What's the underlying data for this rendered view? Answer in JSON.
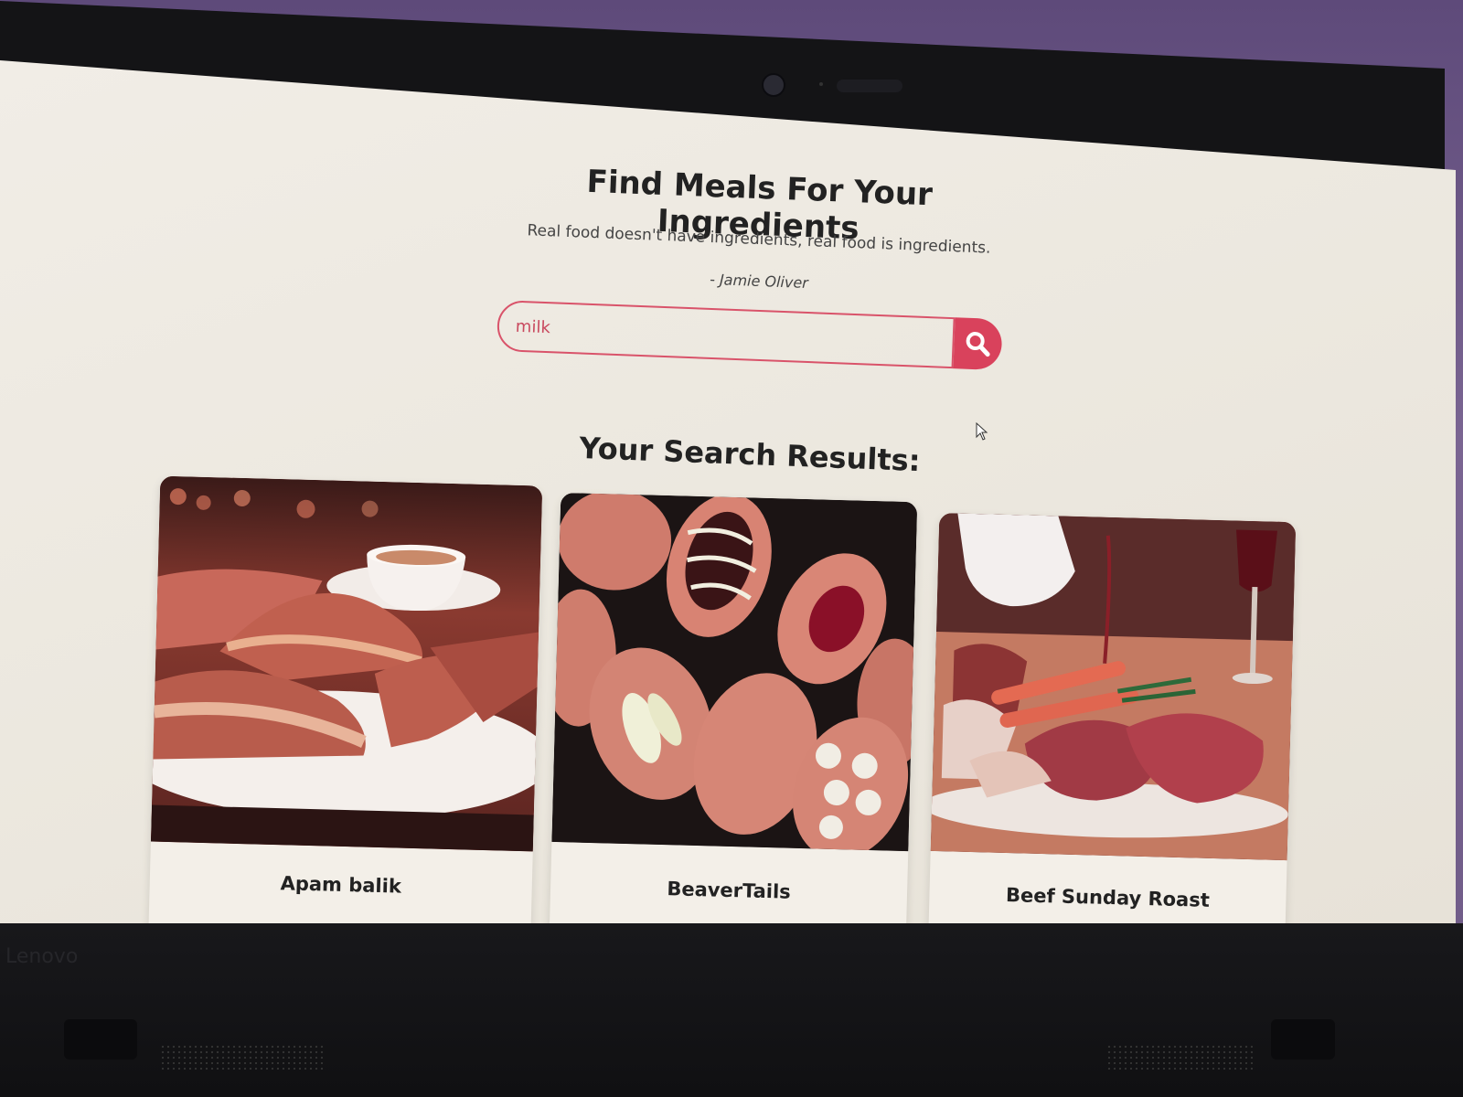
{
  "page": {
    "title": "Find Meals For Your Ingredients",
    "quote": "Real food doesn't have ingredients, real food is ingredients.",
    "quote_author": "- Jamie Oliver"
  },
  "search": {
    "value": "milk",
    "button_icon": "search-icon"
  },
  "results": {
    "heading": "Your Search Results:",
    "items": [
      {
        "name": "Apam balik"
      },
      {
        "name": "BeaverTails"
      },
      {
        "name": "Beef Sunday Roast"
      }
    ]
  },
  "device": {
    "brand": "Lenovo"
  },
  "colors": {
    "accent": "#d9425c",
    "background": "#efebe4",
    "text": "#222222"
  }
}
